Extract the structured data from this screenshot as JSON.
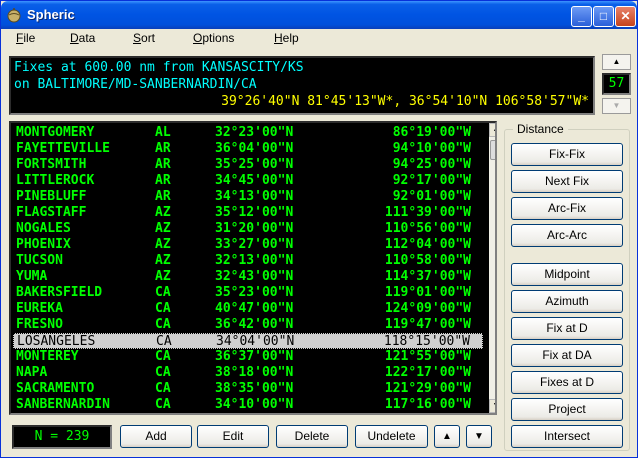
{
  "window": {
    "title": "Spheric",
    "controls": [
      "_",
      "□",
      "✕"
    ]
  },
  "menu": [
    {
      "key": "F",
      "rest": "ile"
    },
    {
      "key": "D",
      "rest": "ata"
    },
    {
      "key": "S",
      "rest": "ort"
    },
    {
      "key": "O",
      "rest": "ptions"
    },
    {
      "key": "H",
      "rest": "elp"
    }
  ],
  "header": {
    "line1": "Fixes at 600.00 nm from KANSASCITY/KS",
    "line2": "on BALTIMORE/MD-SANBERNARDIN/CA",
    "line3": "39°26'40\"N 81°45'13\"W*, 36°54'10\"N 106°58'57\"W*"
  },
  "spinner": {
    "value": "57"
  },
  "fixes": [
    {
      "city": "MONTGOMERY",
      "state": "AL",
      "lat": "32°23'00\"N",
      "lon": "86°19'00\"W"
    },
    {
      "city": "FAYETTEVILLE",
      "state": "AR",
      "lat": "36°04'00\"N",
      "lon": "94°10'00\"W"
    },
    {
      "city": "FORTSMITH",
      "state": "AR",
      "lat": "35°25'00\"N",
      "lon": "94°25'00\"W"
    },
    {
      "city": "LITTLEROCK",
      "state": "AR",
      "lat": "34°45'00\"N",
      "lon": "92°17'00\"W"
    },
    {
      "city": "PINEBLUFF",
      "state": "AR",
      "lat": "34°13'00\"N",
      "lon": "92°01'00\"W"
    },
    {
      "city": "FLAGSTAFF",
      "state": "AZ",
      "lat": "35°12'00\"N",
      "lon": "111°39'00\"W"
    },
    {
      "city": "NOGALES",
      "state": "AZ",
      "lat": "31°20'00\"N",
      "lon": "110°56'00\"W"
    },
    {
      "city": "PHOENIX",
      "state": "AZ",
      "lat": "33°27'00\"N",
      "lon": "112°04'00\"W"
    },
    {
      "city": "TUCSON",
      "state": "AZ",
      "lat": "32°13'00\"N",
      "lon": "110°58'00\"W"
    },
    {
      "city": "YUMA",
      "state": "AZ",
      "lat": "32°43'00\"N",
      "lon": "114°37'00\"W"
    },
    {
      "city": "BAKERSFIELD",
      "state": "CA",
      "lat": "35°23'00\"N",
      "lon": "119°01'00\"W"
    },
    {
      "city": "EUREKA",
      "state": "CA",
      "lat": "40°47'00\"N",
      "lon": "124°09'00\"W"
    },
    {
      "city": "FRESNO",
      "state": "CA",
      "lat": "36°42'00\"N",
      "lon": "119°47'00\"W"
    },
    {
      "city": "LOSANGELES",
      "state": "CA",
      "lat": "34°04'00\"N",
      "lon": "118°15'00\"W",
      "selected": true
    },
    {
      "city": "MONTEREY",
      "state": "CA",
      "lat": "36°37'00\"N",
      "lon": "121°55'00\"W"
    },
    {
      "city": "NAPA",
      "state": "CA",
      "lat": "38°18'00\"N",
      "lon": "122°17'00\"W"
    },
    {
      "city": "SACRAMENTO",
      "state": "CA",
      "lat": "38°35'00\"N",
      "lon": "121°29'00\"W"
    },
    {
      "city": "SANBERNARDIN",
      "state": "CA",
      "lat": "34°10'00\"N",
      "lon": "117°16'00\"W"
    }
  ],
  "count_label": "N = 239",
  "bottom_buttons": [
    "Add",
    "Edit",
    "Delete",
    "Undelete",
    "▲",
    "▼"
  ],
  "distance": {
    "legend": "Distance",
    "buttons": [
      "Fix-Fix",
      "Next Fix",
      "Arc-Fix",
      "Arc-Arc",
      "Midpoint",
      "Azimuth",
      "Fix at D",
      "Fix at DA",
      "Fixes at D",
      "Project",
      "Intersect"
    ]
  },
  "colors": {
    "list_text": "#00ff00",
    "header_cyan": "#00ffff",
    "header_yellow": "#ffff00",
    "title_bar": "#0054e3"
  }
}
